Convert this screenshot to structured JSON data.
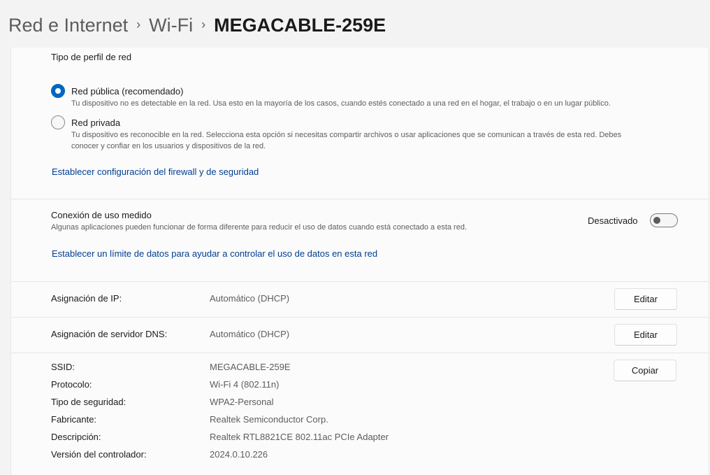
{
  "breadcrumb": {
    "items": [
      "Red e Internet",
      "Wi-Fi"
    ],
    "current": "MEGACABLE-259E",
    "separator": "›"
  },
  "profile": {
    "title": "Tipo de perfil de red",
    "options": [
      {
        "label": "Red pública (recomendado)",
        "description": "Tu dispositivo no es detectable en la red. Usa esto en la mayoría de los casos, cuando estés conectado a una red en el hogar, el trabajo o en un lugar público.",
        "selected": true
      },
      {
        "label": "Red privada",
        "description_line1": "Tu dispositivo es reconocible en la red. Selecciona esta opción si necesitas compartir archivos o usar aplicaciones que se comunican a través de esta red. Debes",
        "description_line2": "conocer y confiar en los usuarios y dispositivos de la red.",
        "selected": false
      }
    ],
    "firewall_link": "Establecer configuración del firewall y de seguridad"
  },
  "metered": {
    "title": "Conexión de uso medido",
    "description": "Algunas aplicaciones pueden funcionar de forma diferente para reducir el uso de datos cuando está conectado a esta red.",
    "state_label": "Desactivado",
    "enabled": false,
    "data_limit_link": "Establecer un límite de datos para ayudar a controlar el uso de datos en esta red"
  },
  "ip": {
    "label": "Asignación de IP:",
    "value": "Automático (DHCP)",
    "button": "Editar"
  },
  "dns": {
    "label": "Asignación de servidor DNS:",
    "value": "Automático (DHCP)",
    "button": "Editar"
  },
  "properties": {
    "copy_button": "Copiar",
    "rows": [
      {
        "label": "SSID:",
        "value": "MEGACABLE-259E"
      },
      {
        "label": "Protocolo:",
        "value": "Wi-Fi 4 (802.11n)"
      },
      {
        "label": "Tipo de seguridad:",
        "value": "WPA2-Personal"
      },
      {
        "label": "Fabricante:",
        "value": "Realtek Semiconductor Corp."
      },
      {
        "label": "Descripción:",
        "value": "Realtek RTL8821CE 802.11ac PCIe Adapter"
      },
      {
        "label": "Versión del controlador:",
        "value": "2024.0.10.226"
      }
    ]
  },
  "colors": {
    "accent": "#0067c0",
    "link": "#003e92",
    "background": "#f3f3f3",
    "card": "#fbfbfb"
  }
}
